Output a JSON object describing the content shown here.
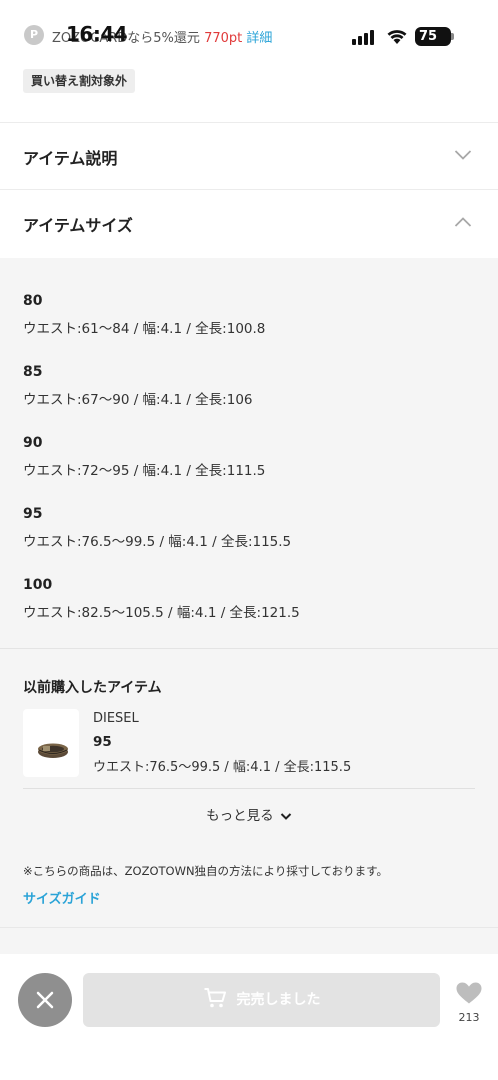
{
  "status_bar": {
    "time": "16:44",
    "promo_icon": "P",
    "promo_prefix": "ZOZOCARDなら5%還元",
    "promo_points": "770pt",
    "promo_detail": "詳細",
    "battery": "75"
  },
  "tag": "買い替え割対象外",
  "accordion": {
    "description_title": "アイテム説明",
    "size_title": "アイテムサイズ"
  },
  "sizes": [
    {
      "label": "80",
      "spec": "ウエスト:61〜84 / 幅:4.1 / 全長:100.8"
    },
    {
      "label": "85",
      "spec": "ウエスト:67〜90 / 幅:4.1 / 全長:106"
    },
    {
      "label": "90",
      "spec": "ウエスト:72〜95 / 幅:4.1 / 全長:111.5"
    },
    {
      "label": "95",
      "spec": "ウエスト:76.5〜99.5 / 幅:4.1 / 全長:115.5"
    },
    {
      "label": "100",
      "spec": "ウエスト:82.5〜105.5 / 幅:4.1 / 全長:121.5"
    }
  ],
  "previous": {
    "title": "以前購入したアイテム",
    "brand": "DIESEL",
    "size": "95",
    "spec": "ウエスト:76.5〜99.5 / 幅:4.1 / 全長:115.5"
  },
  "more_label": "もっと見る",
  "note": "※こちらの商品は、ZOZOTOWN独自の方法により採寸しております。",
  "size_guide": "サイズガイド",
  "action_bar": {
    "soldout_label": "完売しました",
    "favorite_count": "213"
  },
  "colors": {
    "accent_link": "#2aa3d7",
    "points_red": "#e03a3a",
    "panel_bg": "#f5f5f5",
    "close_btn": "#8f8f8f",
    "soldout_bg": "#e3e3e3"
  },
  "icons": [
    "chevron-down-icon",
    "chevron-up-icon",
    "close-icon",
    "cart-icon",
    "heart-icon",
    "signal-icon",
    "wifi-icon",
    "battery-icon"
  ]
}
